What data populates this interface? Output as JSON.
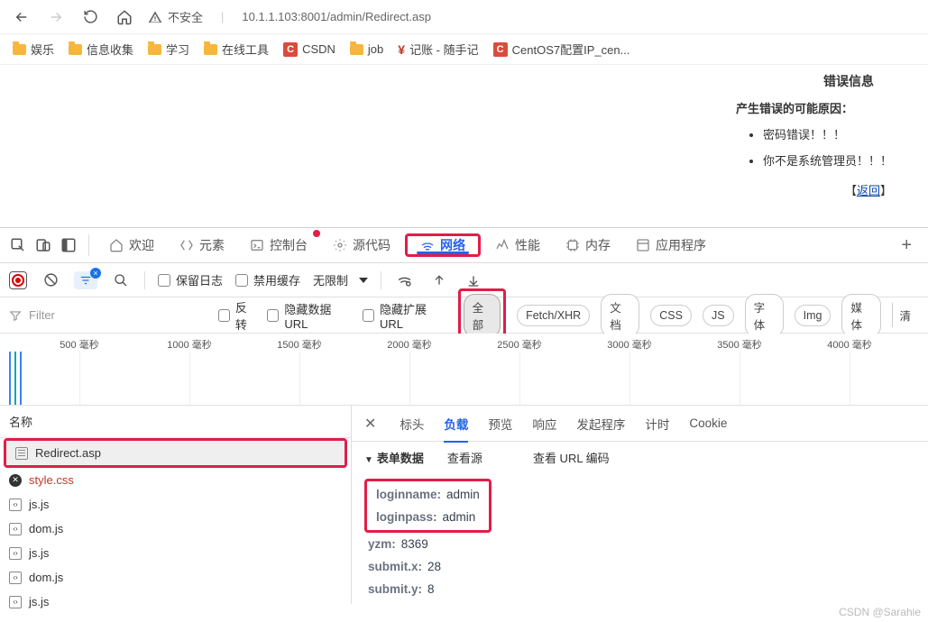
{
  "browser": {
    "insecure_label": "不安全",
    "url": "10.1.1.103:8001/admin/Redirect.asp"
  },
  "bookmarks": [
    {
      "type": "folder",
      "label": "娱乐"
    },
    {
      "type": "folder",
      "label": "信息收集"
    },
    {
      "type": "folder",
      "label": "学习"
    },
    {
      "type": "folder",
      "label": "在线工具"
    },
    {
      "type": "c",
      "label": "CSDN"
    },
    {
      "type": "folder",
      "label": "job"
    },
    {
      "type": "yen",
      "label": "记账 - 随手记"
    },
    {
      "type": "c",
      "label": "CentOS7配置IP_cen..."
    }
  ],
  "page": {
    "title": "错误信息",
    "reason_title": "产生错误的可能原因：",
    "bullets": [
      "密码错误！！！",
      "你不是系统管理员！！！"
    ],
    "back_label": "返回"
  },
  "devtools": {
    "tabs": {
      "welcome": "欢迎",
      "elements": "元素",
      "console": "控制台",
      "sources": "源代码",
      "network": "网络",
      "performance": "性能",
      "memory": "内存",
      "application": "应用程序"
    },
    "toolbar2": {
      "preserve_log": "保留日志",
      "disable_cache": "禁用缓存",
      "throttle": "无限制"
    },
    "filter": {
      "placeholder": "Filter",
      "invert": "反转",
      "hide_data_url": "隐藏数据 URL",
      "hide_ext_url": "隐藏扩展 URL",
      "chips": {
        "all": "全部",
        "fetch": "Fetch/XHR",
        "doc": "文档",
        "css": "CSS",
        "js": "JS",
        "font": "字体",
        "img": "Img",
        "media": "媒体",
        "clean": "清"
      }
    },
    "timeline": {
      "ticks": [
        "500 毫秒",
        "1000 毫秒",
        "1500 毫秒",
        "2000 毫秒",
        "2500 毫秒",
        "3000 毫秒",
        "3500 毫秒",
        "4000 毫秒"
      ]
    },
    "requests": {
      "header": "名称",
      "items": [
        {
          "name": "Redirect.asp",
          "type": "doc",
          "selected": true,
          "boxed": true
        },
        {
          "name": "style.css",
          "type": "css",
          "error": true
        },
        {
          "name": "js.js",
          "type": "js"
        },
        {
          "name": "dom.js",
          "type": "js"
        },
        {
          "name": "js.js",
          "type": "js"
        },
        {
          "name": "dom.js",
          "type": "js"
        },
        {
          "name": "js.js",
          "type": "js"
        }
      ]
    },
    "detail": {
      "tabs": {
        "headers": "标头",
        "payload": "负载",
        "preview": "预览",
        "response": "响应",
        "initiator": "发起程序",
        "timing": "计时",
        "cookies": "Cookie"
      },
      "sub": {
        "form_data": "表单数据",
        "view_source": "查看源",
        "view_url_encoded": "查看 URL 编码"
      },
      "form": [
        {
          "k": "loginname:",
          "v": "admin",
          "boxed": true
        },
        {
          "k": "loginpass:",
          "v": "admin",
          "boxed": true
        },
        {
          "k": "yzm:",
          "v": "8369"
        },
        {
          "k": "submit.x:",
          "v": "28"
        },
        {
          "k": "submit.y:",
          "v": "8"
        }
      ]
    }
  },
  "watermark": "CSDN @Sarahie"
}
